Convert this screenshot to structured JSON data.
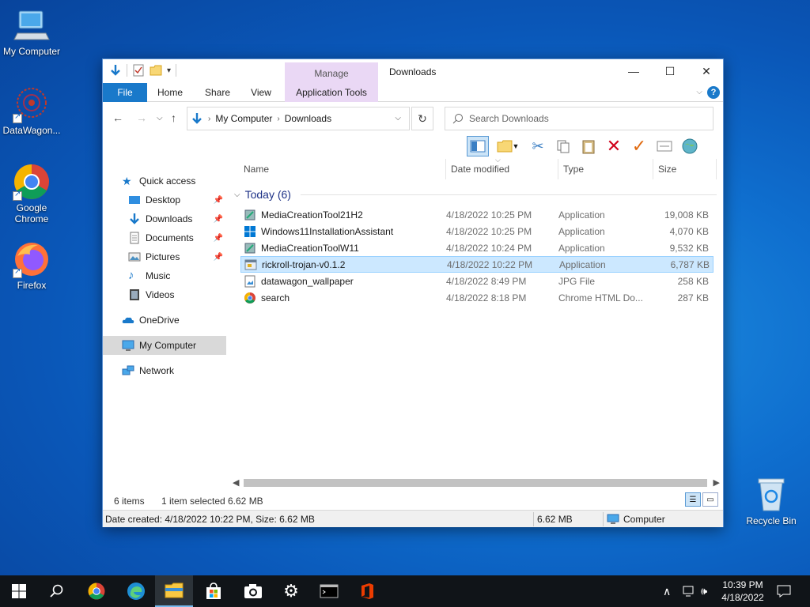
{
  "desktop": {
    "icons": [
      {
        "label": "My Computer"
      },
      {
        "label": "DataWagon..."
      },
      {
        "label": "Google Chrome"
      },
      {
        "label": "Firefox"
      },
      {
        "label": "Recycle Bin"
      }
    ]
  },
  "window": {
    "title": "Downloads",
    "context_group": "Manage",
    "controls": {
      "minimize": "—",
      "maximize": "☐",
      "close": "✕"
    },
    "ribbon_tabs": [
      "File",
      "Home",
      "Share",
      "View",
      "Application Tools"
    ],
    "help_label": "?",
    "address": {
      "segments": [
        "My Computer",
        "Downloads"
      ]
    },
    "search_placeholder": "Search Downloads",
    "nav": {
      "quick_access": "Quick access",
      "items": [
        {
          "label": "Desktop",
          "pinned": true
        },
        {
          "label": "Downloads",
          "pinned": true
        },
        {
          "label": "Documents",
          "pinned": true
        },
        {
          "label": "Pictures",
          "pinned": true
        },
        {
          "label": "Music",
          "pinned": false
        },
        {
          "label": "Videos",
          "pinned": false
        }
      ],
      "onedrive": "OneDrive",
      "my_computer": "My Computer",
      "network": "Network"
    },
    "columns": [
      "Name",
      "Date modified",
      "Type",
      "Size"
    ],
    "group_label": "Today (6)",
    "files": [
      {
        "name": "MediaCreationTool21H2",
        "date": "4/18/2022 10:25 PM",
        "type": "Application",
        "size": "19,008 KB",
        "icon": "media-tool-icon"
      },
      {
        "name": "Windows11InstallationAssistant",
        "date": "4/18/2022 10:25 PM",
        "type": "Application",
        "size": "4,070 KB",
        "icon": "windows-logo-icon"
      },
      {
        "name": "MediaCreationToolW11",
        "date": "4/18/2022 10:24 PM",
        "type": "Application",
        "size": "9,532 KB",
        "icon": "media-tool-icon"
      },
      {
        "name": "rickroll-trojan-v0.1.2",
        "date": "4/18/2022 10:22 PM",
        "type": "Application",
        "size": "6,787 KB",
        "icon": "application-icon",
        "selected": true
      },
      {
        "name": "datawagon_wallpaper",
        "date": "4/18/2022 8:49 PM",
        "type": "JPG File",
        "size": "258 KB",
        "icon": "image-file-icon"
      },
      {
        "name": "search",
        "date": "4/18/2022 8:18 PM",
        "type": "Chrome HTML Do...",
        "size": "287 KB",
        "icon": "chrome-icon"
      }
    ],
    "status": {
      "items": "6 items",
      "selected": "1 item selected",
      "size": "6.62 MB"
    },
    "details": {
      "info": "Date created: 4/18/2022 10:22 PM, Size: 6.62 MB",
      "size": "6.62 MB",
      "location": "Computer"
    }
  },
  "taskbar": {
    "clock_time": "10:39 PM",
    "clock_date": "4/18/2022"
  },
  "colors": {
    "accent": "#1979ca",
    "selection": "#cce8ff",
    "taskbar": "#101418"
  }
}
